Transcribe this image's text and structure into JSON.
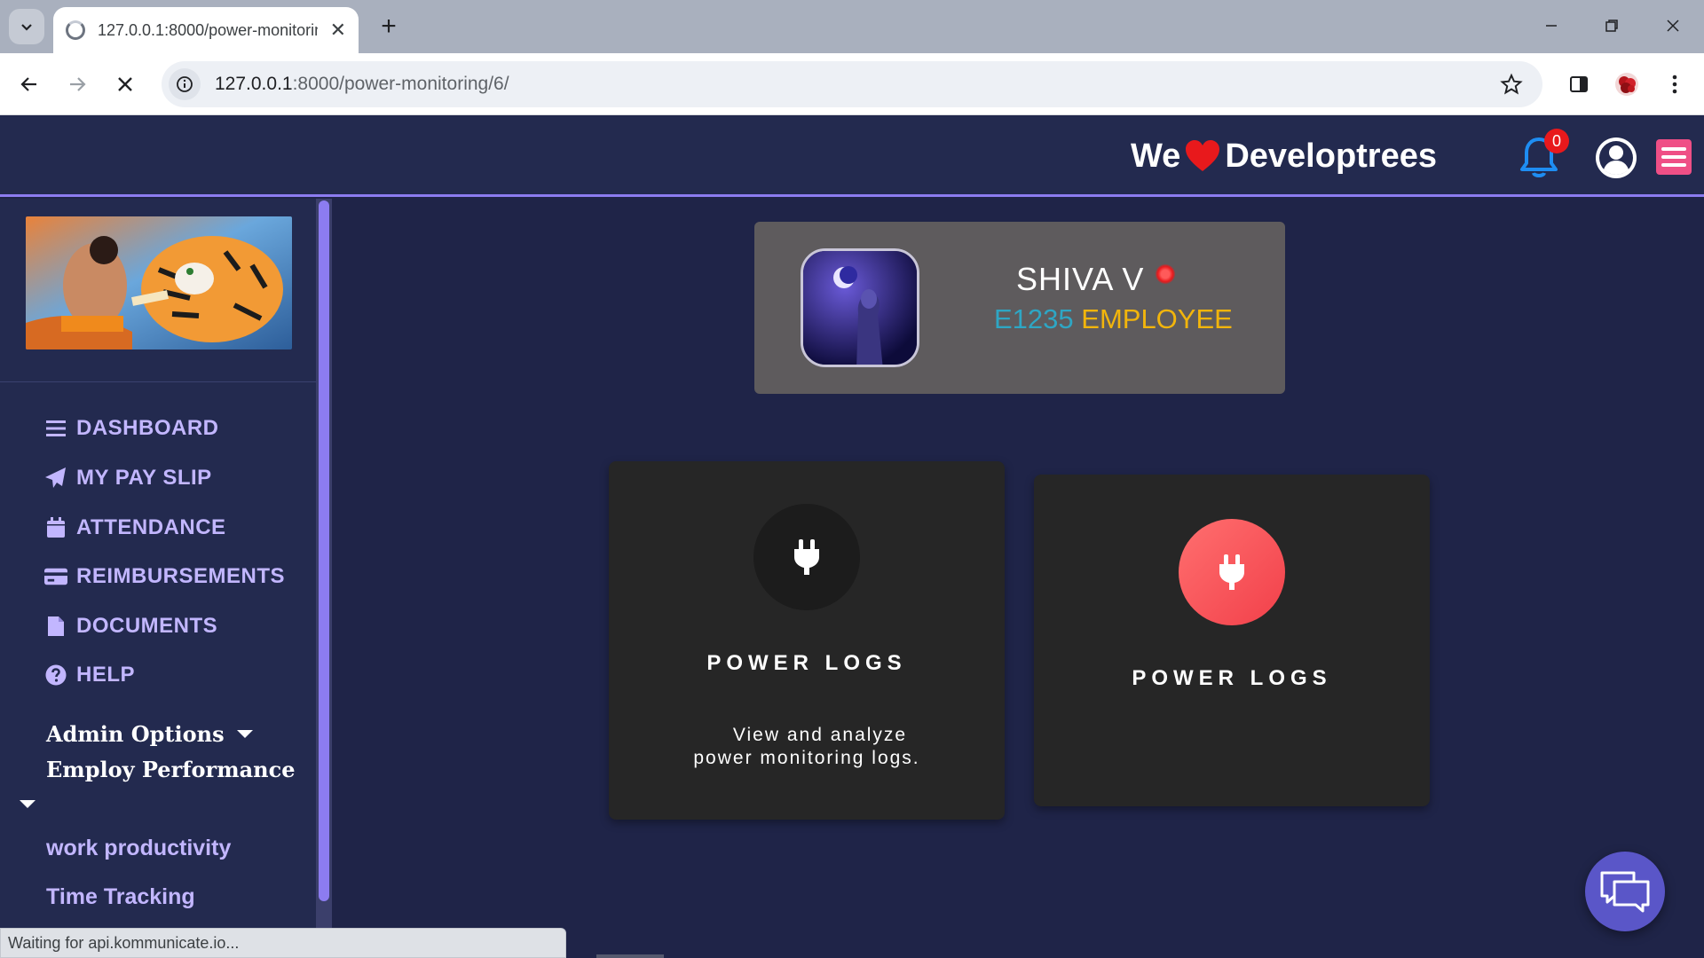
{
  "browser": {
    "tab_title": "127.0.0.1:8000/power-monitoring/6/",
    "url_host": "127.0.0.1",
    "url_path": ":8000/power-monitoring/6/",
    "status_text": "Waiting for api.kommunicate.io..."
  },
  "header": {
    "brand_left": "We",
    "brand_right": "Developtrees",
    "notification_count": "0",
    "accent_color": "#8c7cf0",
    "menu_button_color": "#ef4f86"
  },
  "sidebar": {
    "items": [
      {
        "label": "DASHBOARD",
        "icon": "bars-icon"
      },
      {
        "label": "MY PAY SLIP",
        "icon": "paper-plane-icon"
      },
      {
        "label": "ATTENDANCE",
        "icon": "calendar-icon"
      },
      {
        "label": "REIMBURSEMENTS",
        "icon": "credit-card-icon"
      },
      {
        "label": "DOCUMENTS",
        "icon": "file-icon"
      },
      {
        "label": "HELP",
        "icon": "question-circle-icon"
      }
    ],
    "admin_options": "Admin Options",
    "employ_performance": "Employ Performance",
    "sub_links": [
      "work productivity",
      "Time Tracking"
    ]
  },
  "employee": {
    "name": "SHIVA V",
    "id": "E1235",
    "role": "EMPLOYEE",
    "status_color": "#e8191c"
  },
  "cards": [
    {
      "title": "POWER LOGS",
      "description_line1": "View and analyze",
      "description_line2": "power monitoring logs.",
      "icon": "plug-icon"
    },
    {
      "title": "POWER LOGS",
      "icon": "plug-icon"
    }
  ]
}
